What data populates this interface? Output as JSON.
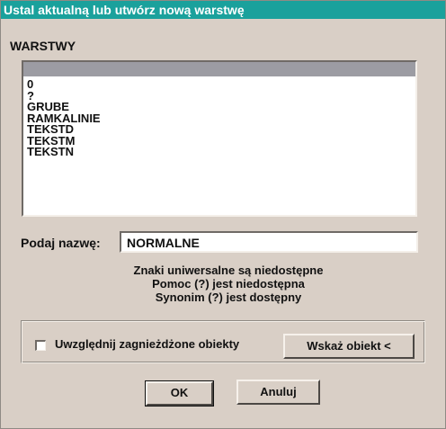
{
  "window": {
    "title": "Ustal aktualną lub utwórz nową warstwę"
  },
  "layers": {
    "label": "WARSTWY",
    "items": [
      "0",
      "?",
      "GRUBE",
      "RAMKALINIE",
      "TEKSTD",
      "TEKSTM",
      "TEKSTN"
    ]
  },
  "name_field": {
    "label": "Podaj nazwę:",
    "value": "NORMALNE"
  },
  "info": {
    "line1": "Znaki uniwersalne są niedostępne",
    "line2": "Pomoc (?) jest niedostępna",
    "line3": "Synonim (?) jest dostępny"
  },
  "nested": {
    "label": "Uwzględnij zagnieżdżone obiekty",
    "checked": false
  },
  "buttons": {
    "pick": "Wskaż obiekt <",
    "ok": "OK",
    "cancel": "Anuluj"
  },
  "colors": {
    "title_bar": "#1aa19c",
    "dialog_bg": "#d9cfc6",
    "list_header": "#9c9ca3"
  }
}
